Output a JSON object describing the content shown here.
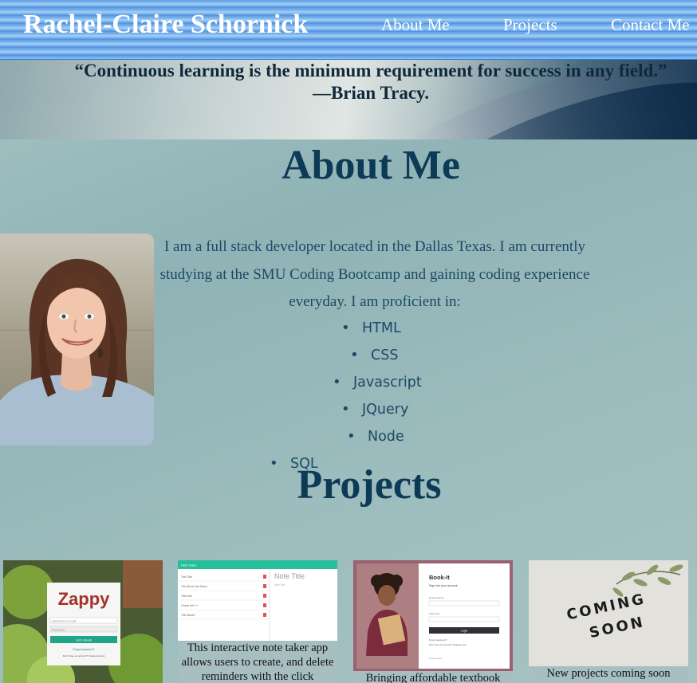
{
  "header": {
    "brand": "Rachel-Claire Schornick",
    "nav": [
      "About Me",
      "Projects",
      "Contact Me"
    ]
  },
  "hero": {
    "quote": "“Continuous learning is the minimum requirement for success in any field.” —Brian Tracy."
  },
  "about": {
    "title": "About Me",
    "intro": "I am a full stack developer located in the Dallas Texas. I am currently studying at the SMU Coding Bootcamp and gaining coding experience everyday. I am proficient in:",
    "skills": [
      "HTML",
      "CSS",
      "Javascript",
      "JQuery",
      "Node",
      "SQL"
    ]
  },
  "projects": {
    "title": "Projects",
    "cards": [
      {
        "name": "Zappy",
        "thumb_text": {
          "logo": "Zappy",
          "button": "Let's Read!",
          "link1": "Forgot password?",
          "link2": "Don't have an account? Create account",
          "field1": "Username or email",
          "field2": "Password"
        },
        "caption": ""
      },
      {
        "name": "Note Taker",
        "thumb_text": {
          "topbar": "Note Taker",
          "notes": [
            "Test Title",
            "This Book Not Taken",
            "Title test",
            "Check this ++",
            "Title Basic?"
          ],
          "editor_title": "Note Title",
          "editor_body": "Note Text"
        },
        "caption": "This interactive note taker app allows users to create, and delete reminders with the click"
      },
      {
        "name": "Book-It",
        "thumb_text": {
          "title": "Book-It",
          "subtitle": "Sign into your account",
          "field1": "Email address",
          "field2": "Password",
          "button": "Login",
          "link1": "Forgot password?",
          "link2": "Don't have an account? Register here",
          "footer": "Terms of use"
        },
        "caption": "Bringing affordable textbook"
      },
      {
        "name": "Coming Soon",
        "thumb_text": {
          "sign_line1": "COMING",
          "sign_line2": "SOON"
        },
        "caption": "New projects coming soon"
      }
    ]
  },
  "colors": {
    "header_blue": "#5d9fe6",
    "title_navy": "#0d3a56",
    "body_text": "#1d4866",
    "teal_button": "#1fa589",
    "note_teal": "#27bf9b"
  }
}
